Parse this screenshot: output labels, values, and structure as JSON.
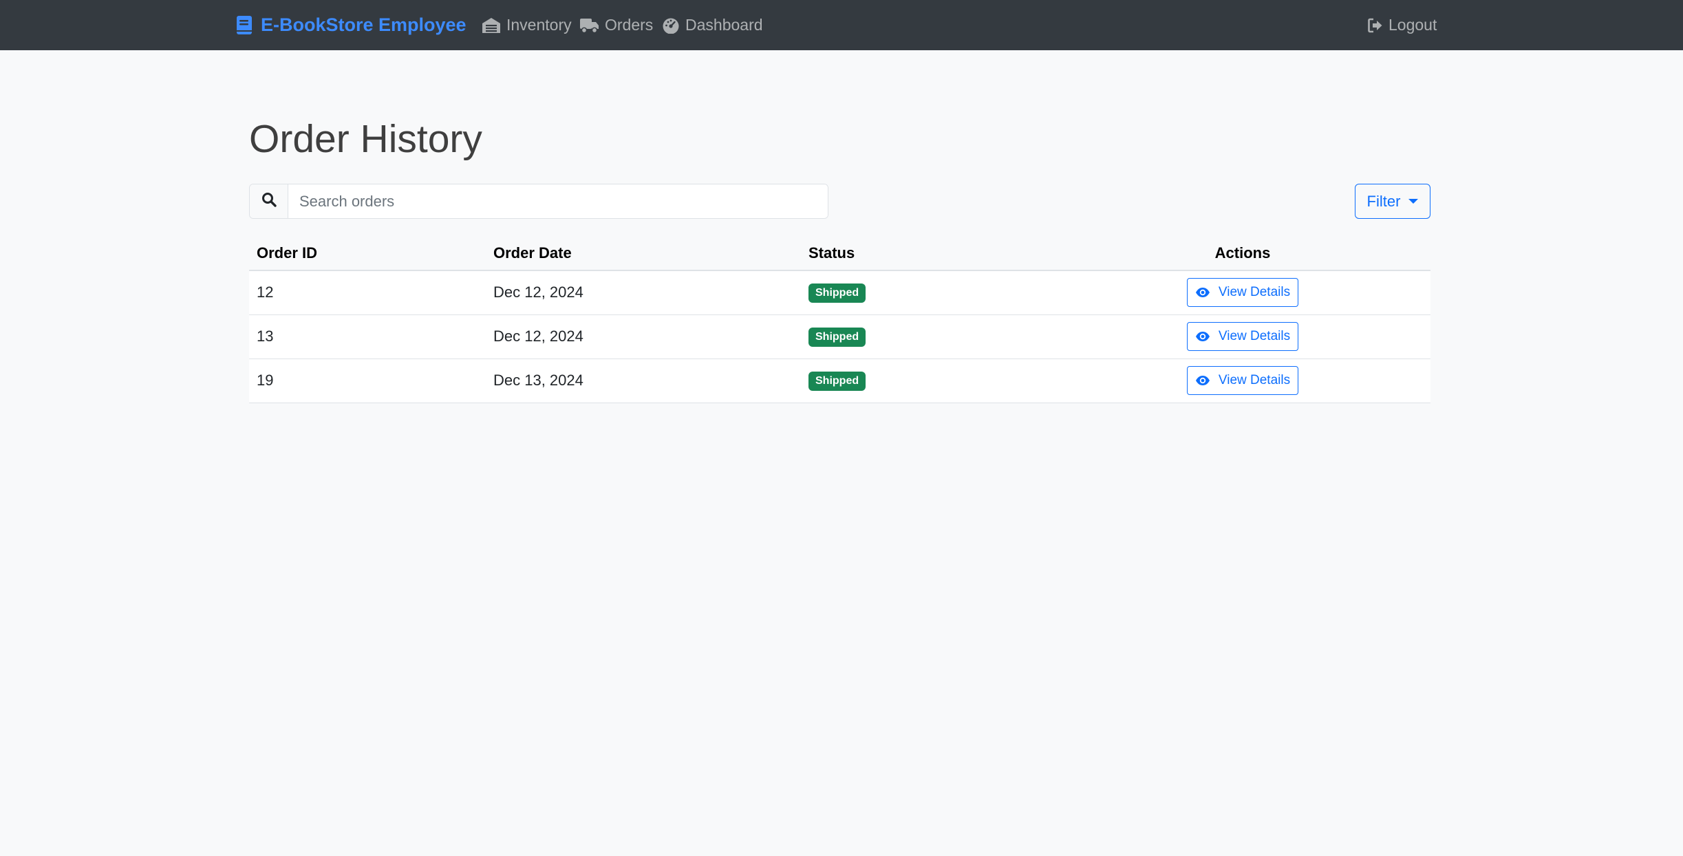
{
  "navbar": {
    "brand": "E-BookStore Employee",
    "brand_icon": "book-icon",
    "items": [
      {
        "label": "Inventory",
        "icon": "warehouse-icon"
      },
      {
        "label": "Orders",
        "icon": "truck-icon"
      },
      {
        "label": "Dashboard",
        "icon": "gauge-icon"
      }
    ],
    "logout": {
      "label": "Logout",
      "icon": "sign-out-icon"
    }
  },
  "main": {
    "title": "Order History",
    "search": {
      "placeholder": "Search orders",
      "value": "",
      "icon": "search-icon"
    },
    "filter_label": "Filter",
    "table": {
      "headers": {
        "order_id": "Order ID",
        "order_date": "Order Date",
        "status": "Status",
        "actions": "Actions"
      },
      "rows": [
        {
          "order_id": "12",
          "order_date": "Dec 12, 2024",
          "status": "Shipped",
          "action": "View Details"
        },
        {
          "order_id": "13",
          "order_date": "Dec 12, 2024",
          "status": "Shipped",
          "action": "View Details"
        },
        {
          "order_id": "19",
          "order_date": "Dec 13, 2024",
          "status": "Shipped",
          "action": "View Details"
        }
      ]
    }
  },
  "colors": {
    "navbar_bg": "#343a40",
    "brand": "#3d8bfd",
    "primary": "#0d6efd",
    "success_badge": "#198754",
    "page_bg": "#f8f9fa"
  }
}
